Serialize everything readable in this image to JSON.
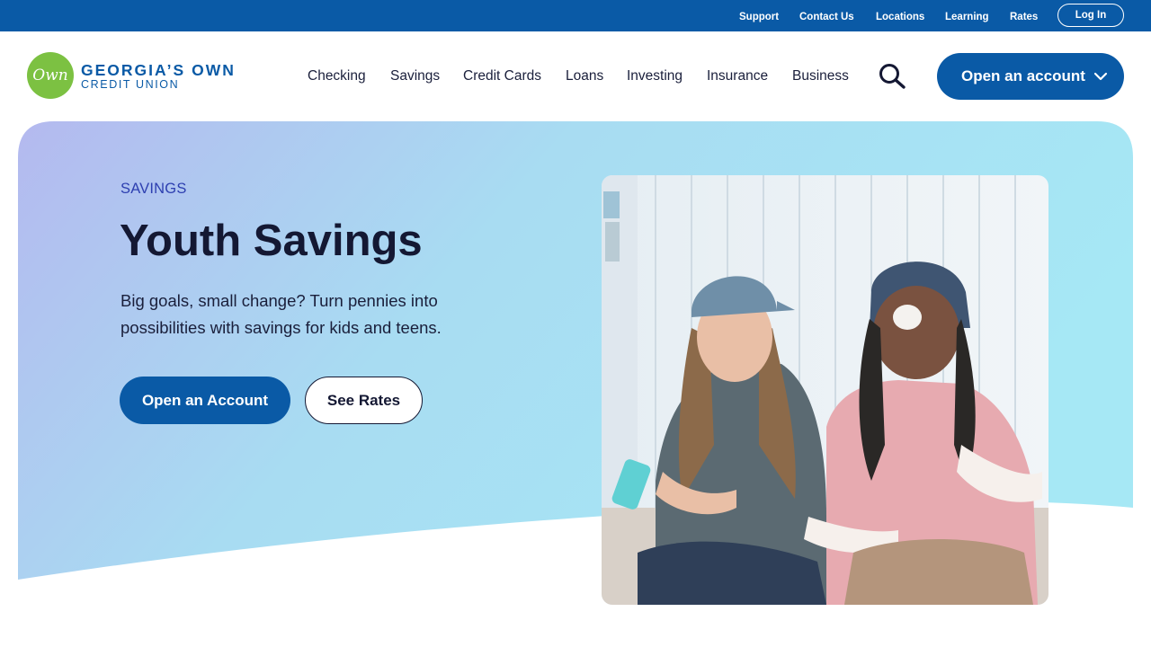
{
  "utility_nav": {
    "links": [
      "Support",
      "Contact Us",
      "Locations",
      "Learning",
      "Rates"
    ],
    "login_label": "Log In"
  },
  "brand": {
    "mark": "Own",
    "name": "GEORGIA’S OWN",
    "sub": "CREDIT UNION"
  },
  "main_nav": {
    "items": [
      "Checking",
      "Savings",
      "Credit Cards",
      "Loans",
      "Investing",
      "Insurance",
      "Business"
    ],
    "cta_label": "Open an account"
  },
  "hero": {
    "eyebrow": "SAVINGS",
    "title": "Youth Savings",
    "description": "Big goals, small change? Turn pennies into possibilities with savings for kids and teens.",
    "primary_button": "Open an Account",
    "secondary_button": "See Rates"
  },
  "colors": {
    "brand_blue": "#0a5aa6",
    "brand_green": "#7cc142",
    "heading_navy": "#141833",
    "eyebrow_blue": "#2d3fb0",
    "hero_gradient_start": "#b4b9ef",
    "hero_gradient_end": "#a6e8f5"
  },
  "icons": {
    "search": "search-icon",
    "cta_chevron": "chevron-down-icon"
  }
}
